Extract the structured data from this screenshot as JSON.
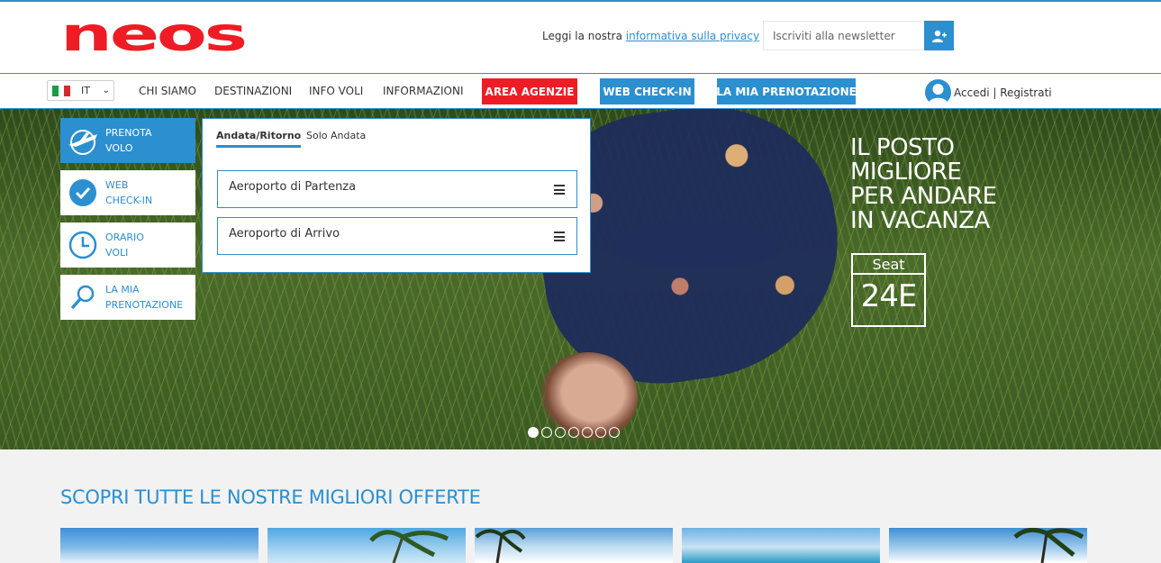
{
  "header": {
    "logo_text": "neos",
    "privacy_prefix": "Leggi la nostra ",
    "privacy_link": "informativa sulla privacy",
    "newsletter_placeholder": "Iscriviti alla newsletter"
  },
  "nav": {
    "language": "IT",
    "links": [
      "CHI SIAMO",
      "DESTINAZIONI",
      "INFO VOLI",
      "INFORMAZIONI"
    ],
    "buttons": [
      "AREA AGENZIE",
      "WEB CHECK-IN",
      "LA MIA PRENOTAZIONE"
    ],
    "account": "Accedi | Registrati"
  },
  "hero": {
    "headline": [
      "IL POSTO",
      "MIGLIORE",
      "PER ANDARE",
      "IN VACANZA"
    ],
    "seat_label": "Seat",
    "seat_number": "24E",
    "slides_total": 7,
    "slide_active": 1
  },
  "booking": {
    "side_buttons": [
      "PRENOTA\nVOLO",
      "WEB\nCHECK-IN",
      "ORARIO\nVOLI",
      "LA MIA\nPRENOTAZIONE"
    ],
    "tabs": [
      "Andata/Ritorno",
      "Solo Andata"
    ],
    "departure": "Aeroporto di Partenza",
    "arrival": "Aeroporto di Arrivo"
  },
  "offers": {
    "title": "SCOPRI TUTTE LE NOSTRE MIGLIORI OFFERTE"
  },
  "colors": {
    "brand_blue": "#2b8fd0",
    "brand_red": "#ee1c25"
  }
}
